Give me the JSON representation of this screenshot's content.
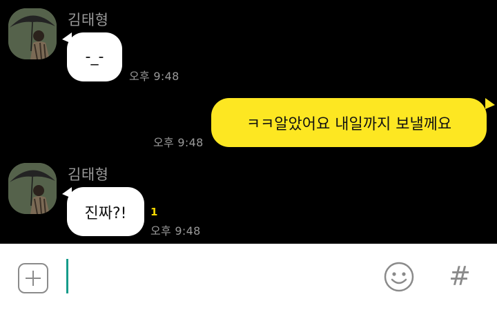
{
  "messages": [
    {
      "sender": "김태형",
      "text": "-_-",
      "time": "오후 9:48"
    },
    {
      "text": "ㅋㅋ알았어요 내일까지 보낼께요",
      "time": "오후 9:48"
    },
    {
      "sender": "김태형",
      "text": "진짜?!",
      "time": "오후 9:48",
      "unread": "1"
    }
  ],
  "composer": {
    "plus_icon": "plus-square-icon",
    "emoji_icon": "smiley-icon",
    "hash_label": "#"
  },
  "colors": {
    "chat_background": "#000000",
    "incoming_bubble": "#ffffff",
    "outgoing_bubble": "#fde722",
    "unread_badge": "#f4d800",
    "caret": "#159b8a"
  }
}
